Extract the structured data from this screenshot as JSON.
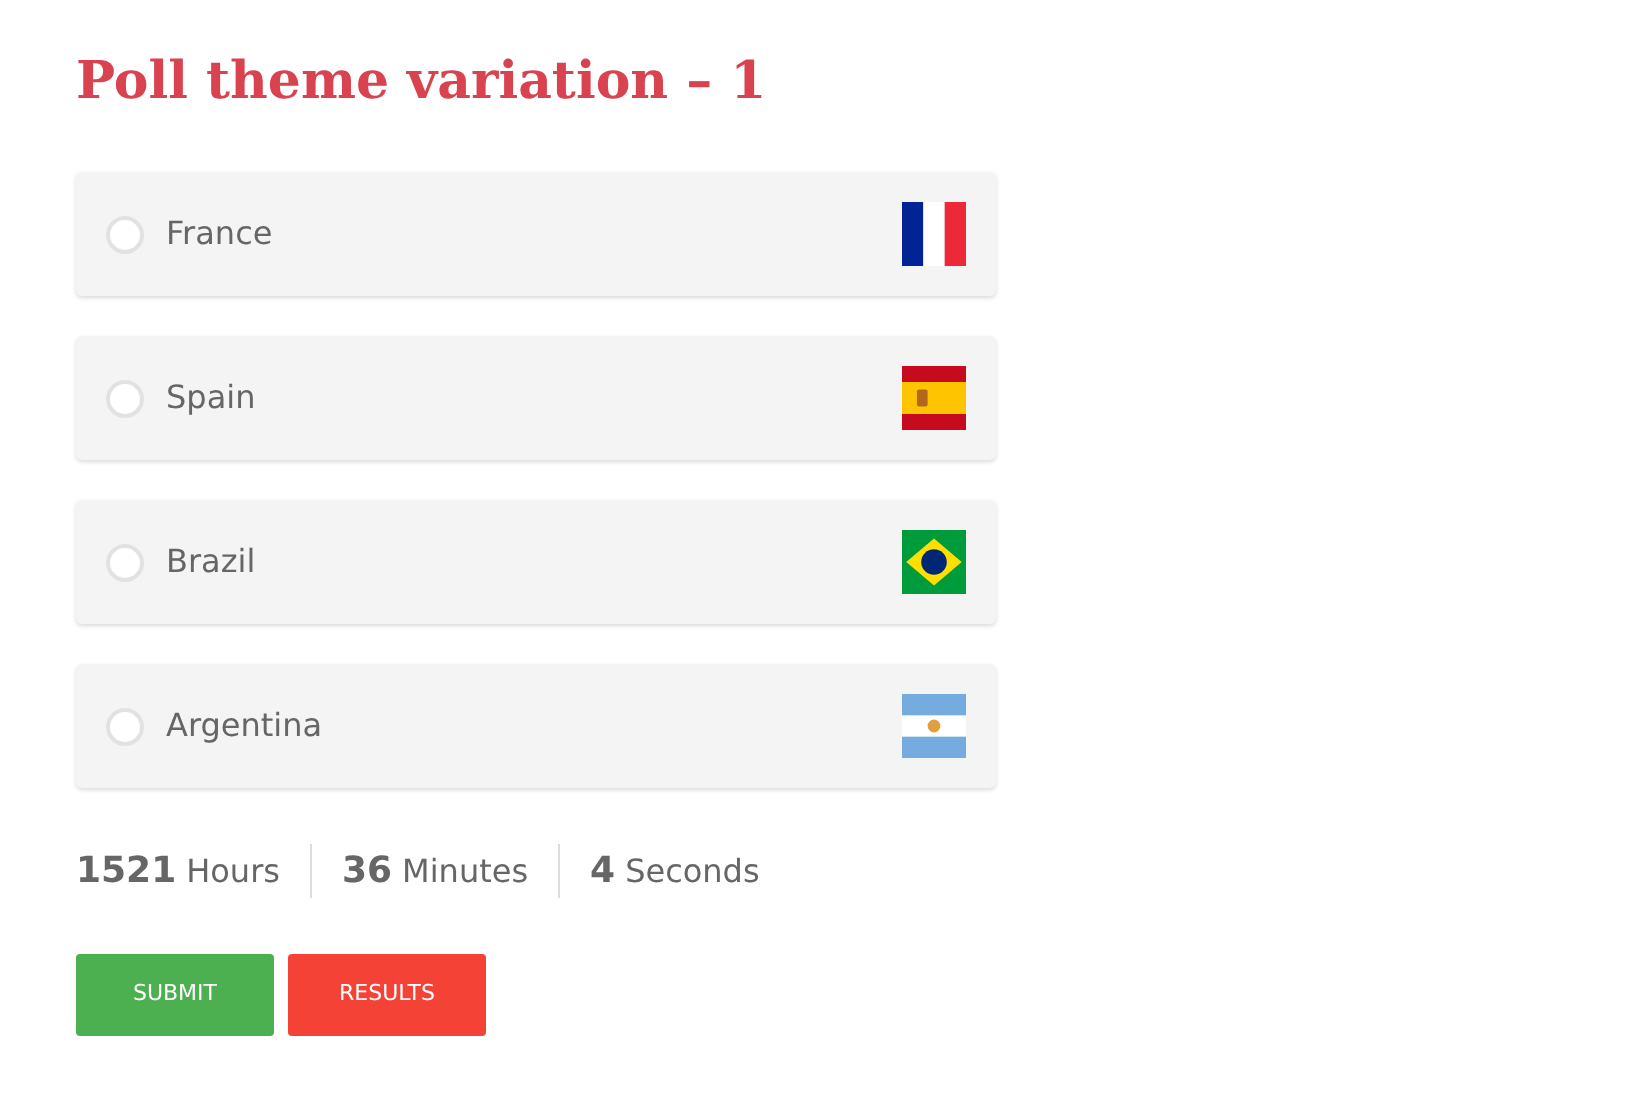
{
  "title": "Poll theme variation – 1",
  "options": [
    {
      "label": "France",
      "selected": false,
      "kind": "france"
    },
    {
      "label": "Spain",
      "selected": false,
      "kind": "spain"
    },
    {
      "label": "Brazil",
      "selected": false,
      "kind": "brazil"
    },
    {
      "label": "Argentina",
      "selected": false,
      "kind": "argentina"
    }
  ],
  "countdown": [
    {
      "value": "1521",
      "unit": "Hours"
    },
    {
      "value": "36",
      "unit": "Minutes"
    },
    {
      "value": "4",
      "unit": "Seconds"
    }
  ],
  "buttons": [
    {
      "label": "SUBMIT",
      "kind": "submit"
    },
    {
      "label": "RESULTS",
      "kind": "results"
    }
  ]
}
